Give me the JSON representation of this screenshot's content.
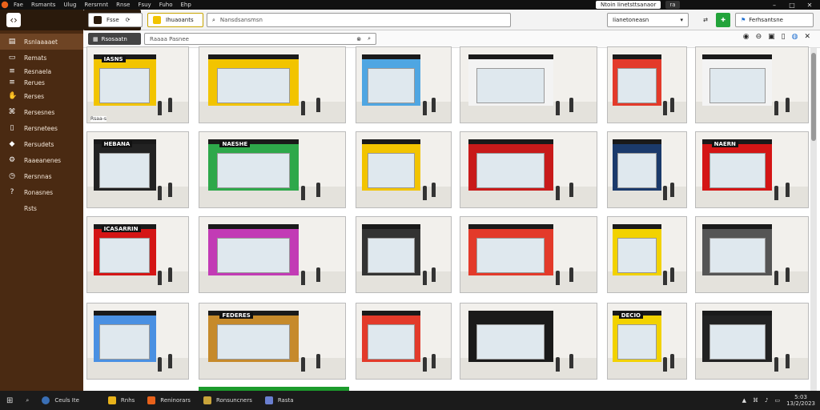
{
  "menubar": {
    "items": [
      "Fae",
      "Rsmants",
      "Ulug",
      "Rersrnnt",
      "Rnse",
      "Fsuy",
      "Fuho",
      "Ehp"
    ],
    "address": "Ntoin    Iinetsttsanaor",
    "badge": "ra"
  },
  "sidebar": {
    "items": [
      {
        "label": "Rsnlaaaaet",
        "icon": "folder-icon"
      },
      {
        "label": "Remats",
        "icon": "image-icon"
      },
      {
        "label": "Resnaela",
        "icon": "list-icon"
      },
      {
        "label": "Rerues",
        "icon": "list-icon"
      },
      {
        "label": "Rerses",
        "icon": "hand-icon"
      },
      {
        "label": "Rersesnes",
        "icon": "tag-icon"
      },
      {
        "label": "Rersnetees",
        "icon": "doc-icon"
      },
      {
        "label": "Rersudets",
        "icon": "bookmark-icon"
      },
      {
        "label": "Raaeanenes",
        "icon": "settings-icon"
      },
      {
        "label": "Rersnnas",
        "icon": "clock-icon"
      },
      {
        "label": "Ronasnes",
        "icon": "help-icon"
      },
      {
        "label": "Rsts",
        "icon": "more-icon"
      }
    ]
  },
  "toolbar": {
    "home_label": "Fsse",
    "app_label": "Ihuaoants",
    "search_placeholder": "Nansdsansmsn",
    "filter_label": "Iianetoneasn",
    "user_label": "Ferhsantsne"
  },
  "subbar": {
    "view_label": "Rsosaatn",
    "path_placeholder": "Raaaa  Pasnee"
  },
  "grid": {
    "tiles": [
      {
        "sign": "IASNS",
        "color": "#f2c400",
        "caption": "Rsaa-s"
      },
      {
        "sign": "",
        "color": "#f2c400"
      },
      {
        "sign": "",
        "color": "#4fa6e2"
      },
      {
        "sign": "",
        "color": "#f3f3f3"
      },
      {
        "sign": "",
        "color": "#e33a2a"
      },
      {
        "sign": "",
        "color": "#f3f3f3"
      },
      {
        "sign": "HEBANA",
        "color": "#222222"
      },
      {
        "sign": "NAESHE",
        "color": "#2ea84a"
      },
      {
        "sign": "",
        "color": "#f2c400"
      },
      {
        "sign": "",
        "color": "#c81a1a"
      },
      {
        "sign": "",
        "color": "#1b3a6b"
      },
      {
        "sign": "NAERN",
        "color": "#d41515"
      },
      {
        "sign": "ICASARRIN",
        "color": "#d41515"
      },
      {
        "sign": "",
        "color": "#c23bb5"
      },
      {
        "sign": "",
        "color": "#333333"
      },
      {
        "sign": "",
        "color": "#e33a2a"
      },
      {
        "sign": "",
        "color": "#f2d200"
      },
      {
        "sign": "",
        "color": "#555555"
      },
      {
        "sign": "",
        "color": "#4a90e2"
      },
      {
        "sign": "FEDERES",
        "color": "#c68a2b"
      },
      {
        "sign": "",
        "color": "#e33a2a"
      },
      {
        "sign": "",
        "color": "#1a1a1a"
      },
      {
        "sign": "DECIO",
        "color": "#f2d200"
      },
      {
        "sign": "",
        "color": "#222222"
      }
    ]
  },
  "taskbar": {
    "items": [
      "Ceuls Ite",
      "Rnhs",
      "Reninorars",
      "Ronsuncners",
      "Rasta"
    ],
    "time": "5:03",
    "date": "13/2/2023"
  }
}
